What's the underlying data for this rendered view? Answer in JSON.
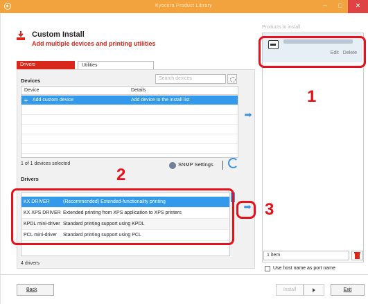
{
  "window": {
    "title": "Kyocera Product Library",
    "minimize": "–",
    "maximize": "□",
    "close": "✕"
  },
  "header": {
    "title": "Custom Install",
    "subtitle": "Add multiple devices and printing utilities",
    "icon": "install-icon"
  },
  "tabs": [
    {
      "label": "Drivers",
      "active": true
    },
    {
      "label": "Utilities",
      "active": false
    }
  ],
  "devices": {
    "section_label": "Devices",
    "search_placeholder": "Search devices",
    "columns": [
      "Device",
      "Details"
    ],
    "rows": [
      {
        "device": "Add custom device",
        "details": "Add device to the install list",
        "selected": true
      }
    ],
    "status": "1 of 1 devices selected",
    "snmp_label": "SNMP Settings"
  },
  "drivers": {
    "section_label": "Drivers",
    "rows": [
      {
        "name": "KX DRIVER",
        "description": "(Recommended) Extended-functionality printing",
        "selected": true
      },
      {
        "name": "KX XPS DRIVER",
        "description": "Extended printing from XPS application to XPS printers",
        "selected": false
      },
      {
        "name": "KPDL mini-driver",
        "description": "Standard printing support using KPDL",
        "selected": false
      },
      {
        "name": "PCL mini-driver",
        "description": "Standard printing support using PCL",
        "selected": false
      }
    ],
    "status": "4 drivers"
  },
  "install_list": {
    "header": "Products to install",
    "card": {
      "edit": "Edit",
      "delete": "Delete"
    },
    "count": "1 item",
    "host_name_option": "Use host name as port name"
  },
  "footer": {
    "back": "Back",
    "install": "Install",
    "exit": "Exit"
  },
  "annotations": [
    "1",
    "2",
    "3"
  ],
  "colors": {
    "titlebar": "#f3a33d",
    "accent": "#d9271c",
    "selection": "#3399ea",
    "annotation": "#e8101a"
  }
}
